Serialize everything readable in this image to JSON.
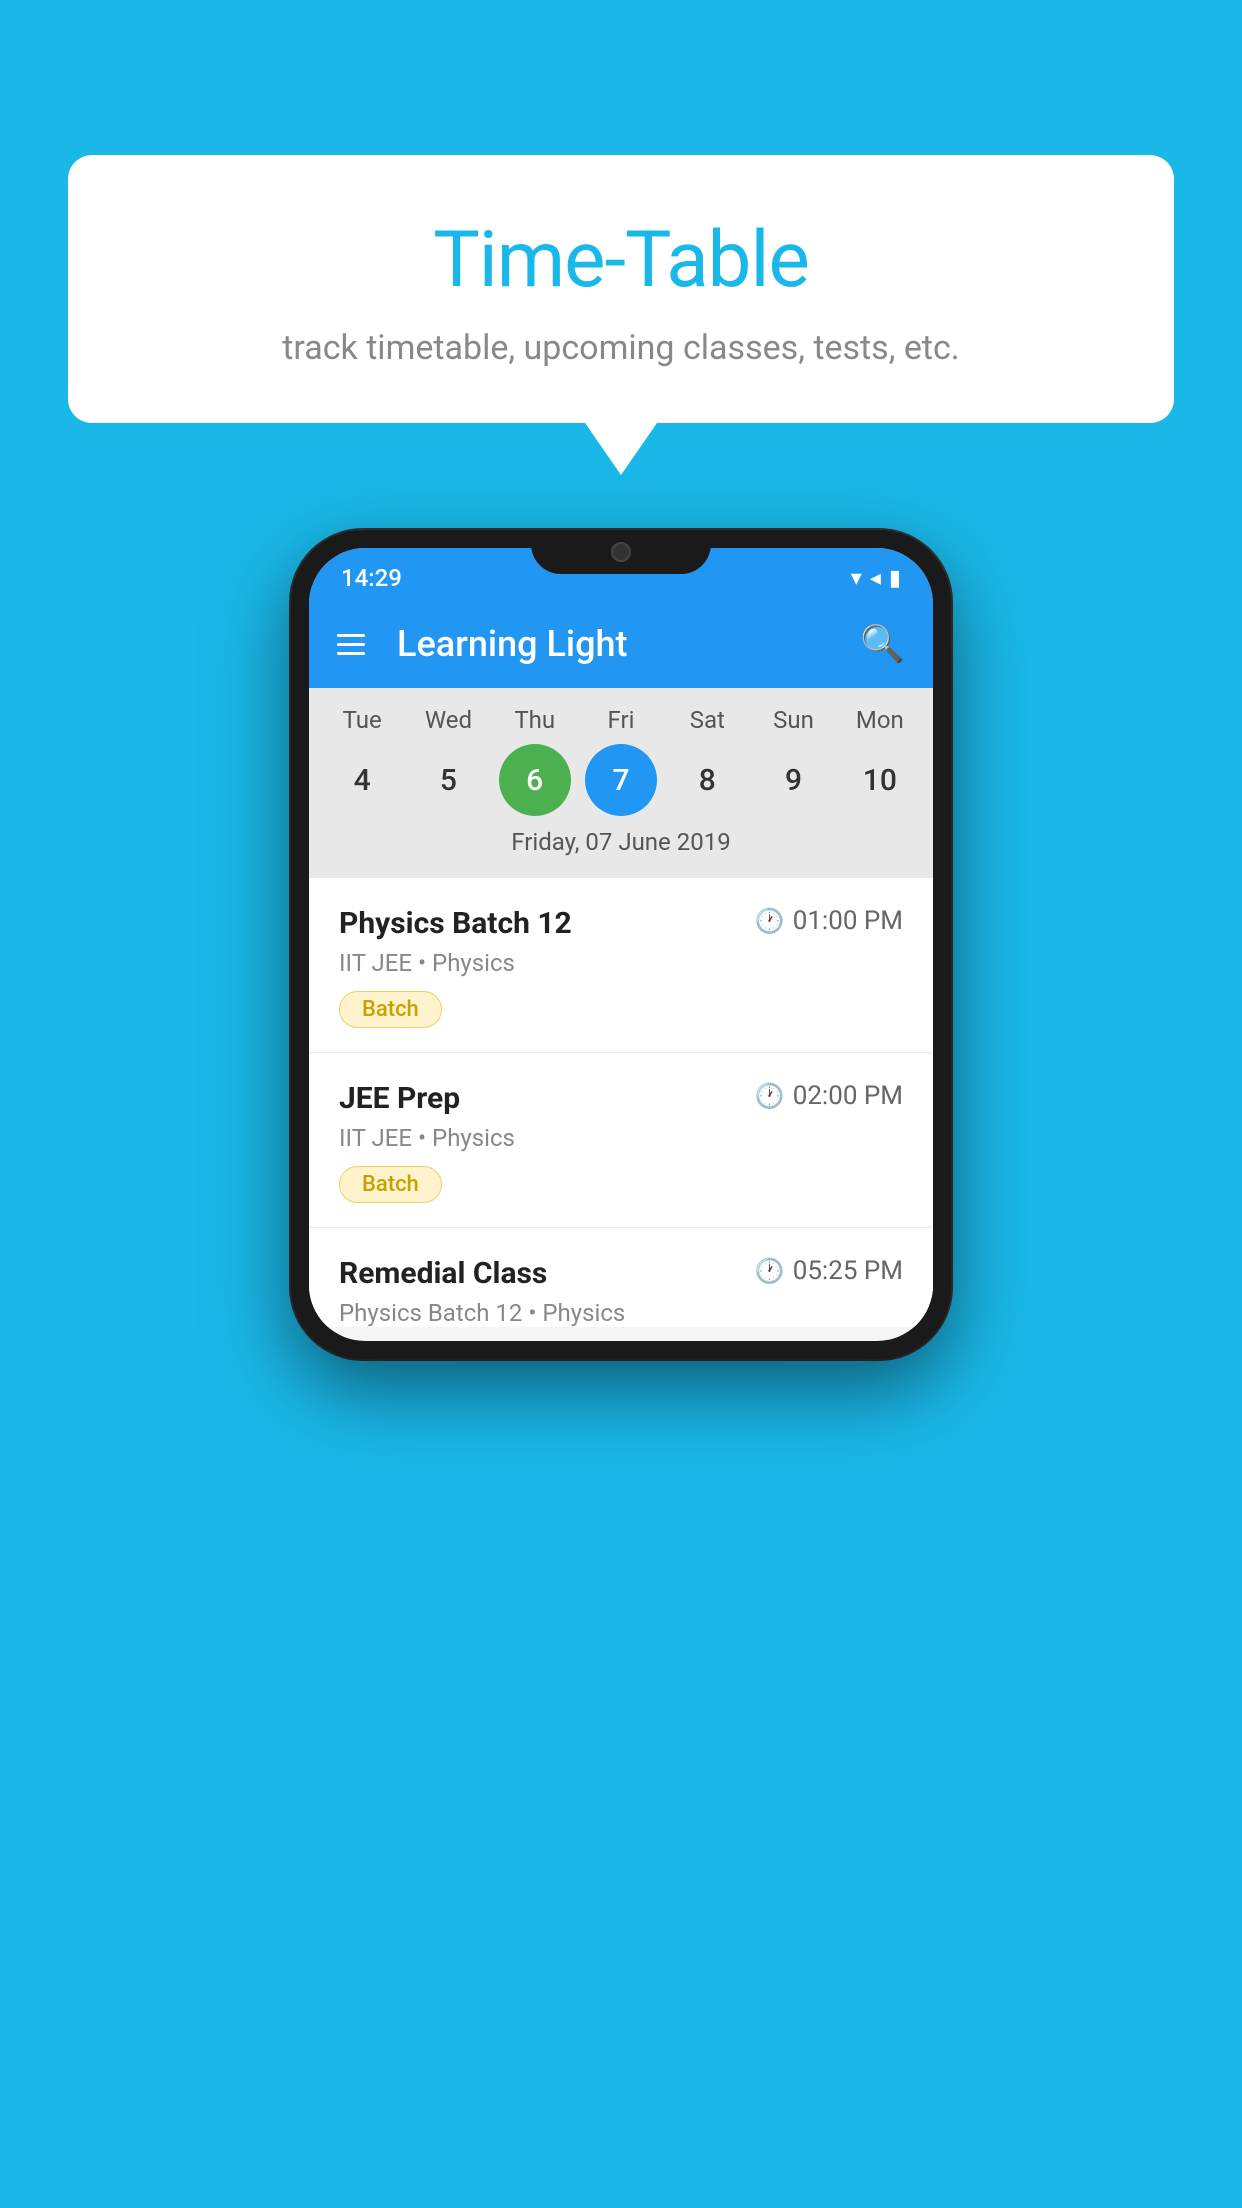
{
  "background_color": "#1ab8e8",
  "speech_bubble": {
    "title": "Time-Table",
    "subtitle": "track timetable, upcoming classes, tests, etc."
  },
  "phone": {
    "status_bar": {
      "time": "14:29",
      "wifi": "▼",
      "signal": "▲",
      "battery": "▮"
    },
    "app_bar": {
      "title": "Learning Light",
      "menu_icon_label": "menu",
      "search_icon_label": "search"
    },
    "calendar": {
      "days": [
        {
          "label": "Tue",
          "num": "4"
        },
        {
          "label": "Wed",
          "num": "5"
        },
        {
          "label": "Thu",
          "num": "6",
          "state": "today"
        },
        {
          "label": "Fri",
          "num": "7",
          "state": "selected"
        },
        {
          "label": "Sat",
          "num": "8"
        },
        {
          "label": "Sun",
          "num": "9"
        },
        {
          "label": "Mon",
          "num": "10"
        }
      ],
      "selected_date_label": "Friday, 07 June 2019"
    },
    "classes": [
      {
        "name": "Physics Batch 12",
        "time": "01:00 PM",
        "meta": "IIT JEE • Physics",
        "tag": "Batch"
      },
      {
        "name": "JEE Prep",
        "time": "02:00 PM",
        "meta": "IIT JEE • Physics",
        "tag": "Batch"
      },
      {
        "name": "Remedial Class",
        "time": "05:25 PM",
        "meta": "Physics Batch 12 • Physics",
        "tag": ""
      }
    ]
  }
}
